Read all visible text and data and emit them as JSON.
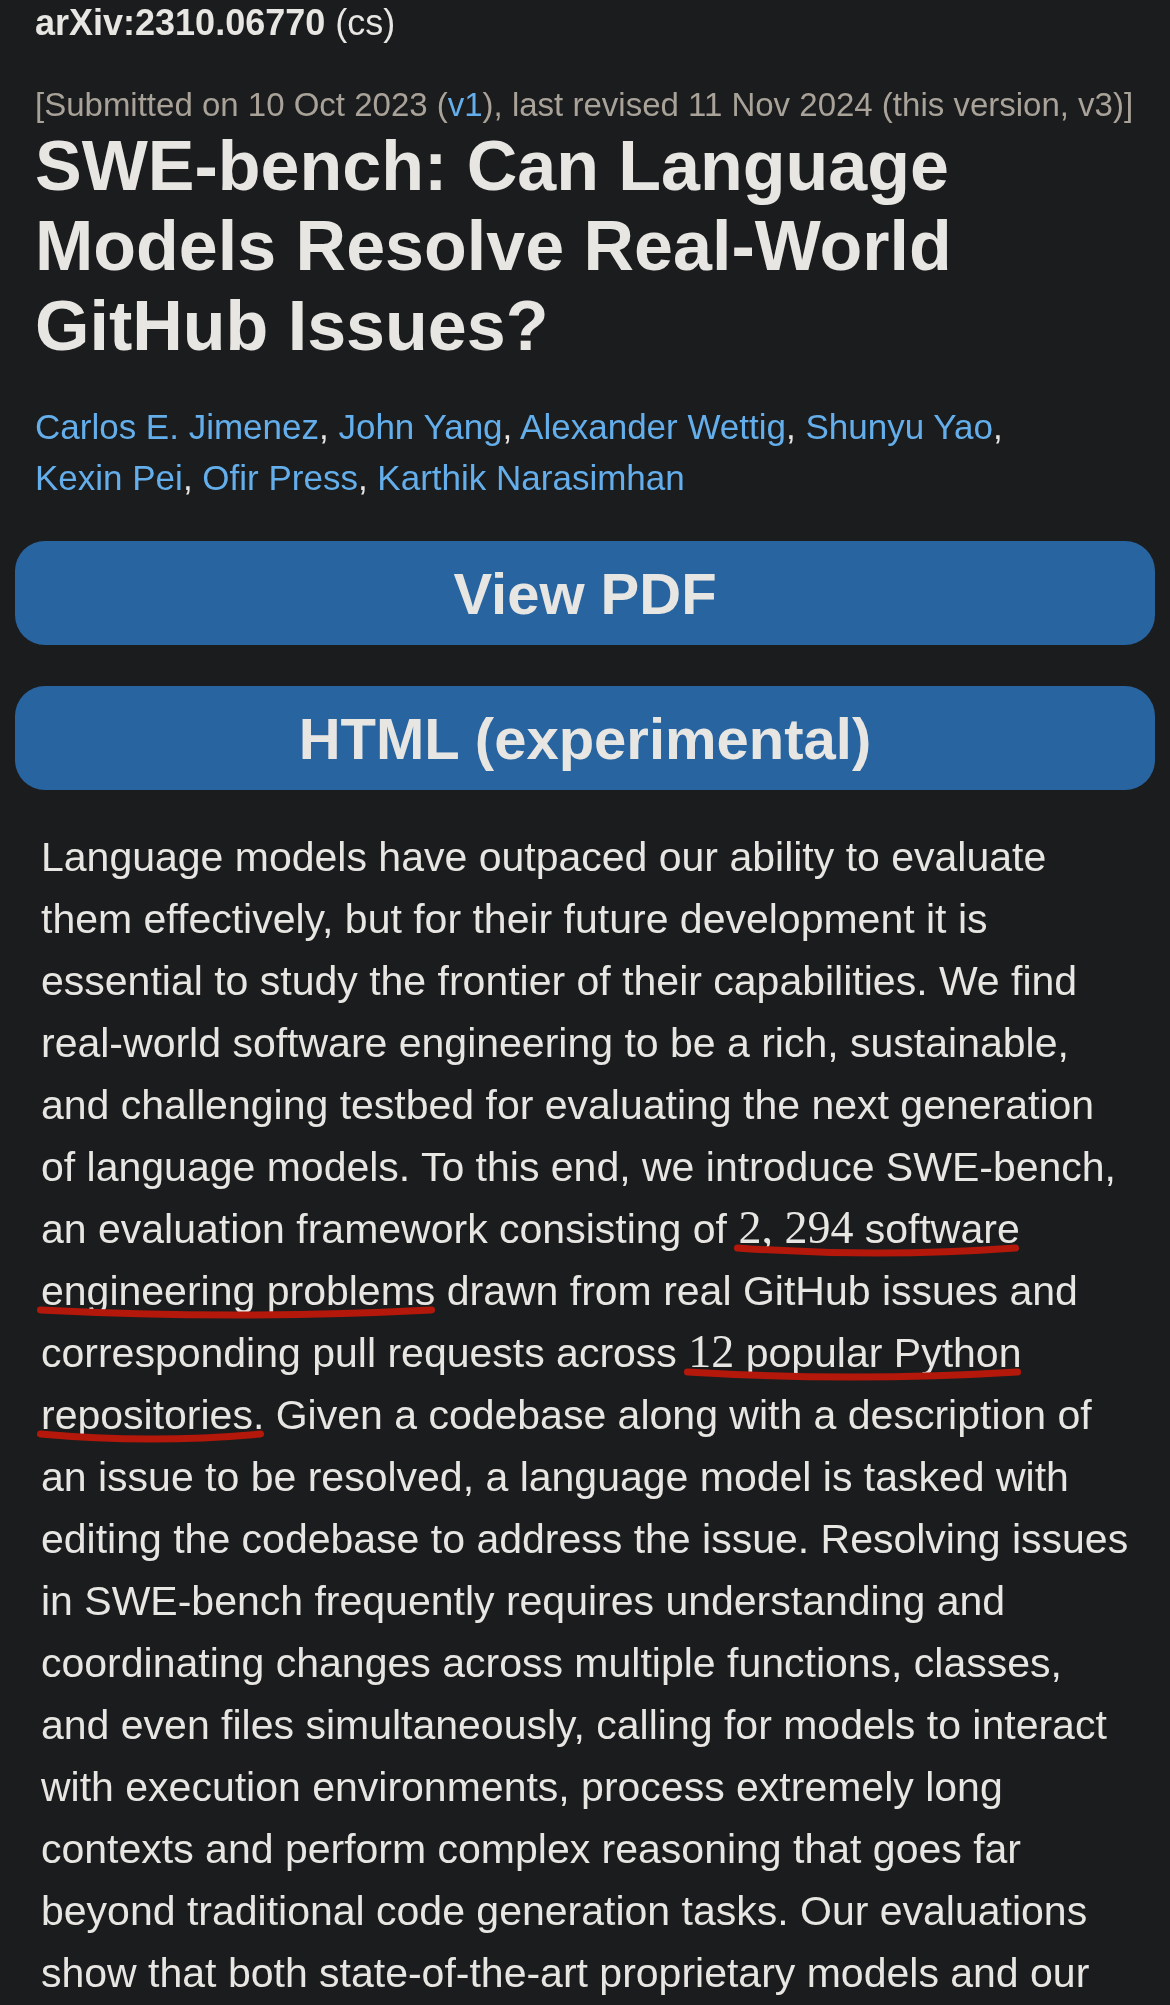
{
  "header": {
    "identifier": "**arXiv:2310.06770** (cs)"
  },
  "submission": {
    "before": "[Submitted on 10 Oct 2023 (",
    "link": "v1",
    "after": "), last revised 11 Nov 2024 (this version, v3)]"
  },
  "title": "SWE-bench: Can Language Models Resolve Real-World GitHub Issues?",
  "authors": {
    "separator": ", ",
    "names": [
      "Carlos E. Jimenez",
      "John Yang",
      "Alexander Wettig",
      "Shunyu Yao",
      "Kexin Pei",
      "Ofir Press",
      "Karthik Narasimhan"
    ]
  },
  "buttons": [
    {
      "label": "View PDF"
    },
    {
      "label": "HTML (experimental)"
    }
  ],
  "abstract": {
    "spans": [
      {
        "underlined": false,
        "parts": [
          {
            "kind": "text",
            "text": "Language models have outpaced our ability to evaluate them effectively, but for their future development it is essential to study the frontier of their capabilities. We find real-world software engineering to be a rich, sustainable, and challenging testbed for evaluating the next generation of language models. To this end, we introduce SWE-bench, an evaluation framework consisting of "
          }
        ]
      },
      {
        "underlined": true,
        "parts": [
          {
            "kind": "math",
            "text": "2, 294"
          },
          {
            "kind": "text",
            "text": " software engineering problems"
          }
        ]
      },
      {
        "underlined": false,
        "parts": [
          {
            "kind": "text",
            "text": " drawn from real GitHub issues and corresponding pull requests across "
          }
        ]
      },
      {
        "underlined": true,
        "parts": [
          {
            "kind": "math",
            "text": "12"
          },
          {
            "kind": "text",
            "text": " popular Python repositories."
          }
        ]
      },
      {
        "underlined": false,
        "parts": [
          {
            "kind": "text",
            "text": " Given a codebase along with a description of an issue to be resolved, a language model is tasked with editing the codebase to address the issue. Resolving issues in SWE-bench frequently requires understanding and coordinating changes across multiple functions, classes, and even files simultaneously, calling for models to interact with execution environments, process extremely long contexts and perform complex reasoning that goes far beyond traditional code generation tasks. Our evaluations show that both state-of-the-art proprietary models and our"
          }
        ]
      }
    ]
  }
}
